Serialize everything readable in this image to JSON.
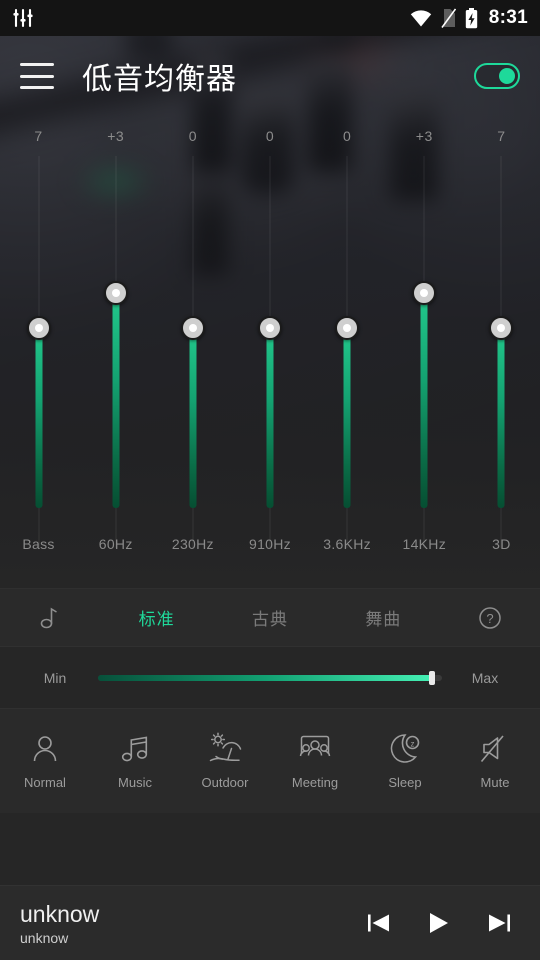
{
  "statusbar": {
    "left_icon": "equalizer-icon",
    "wifi_icon": "wifi-icon",
    "sim_icon": "no-sim-icon",
    "battery_icon": "battery-charging-icon",
    "time": "8:31"
  },
  "appbar": {
    "menu_icon": "hamburger-menu-icon",
    "title": "低音均衡器",
    "toggle_icon": "power-toggle",
    "toggle_on": true,
    "accent": "#1ed99a"
  },
  "equalizer": {
    "bands": [
      {
        "label": "Bass",
        "value": "7",
        "position": 0.3
      },
      {
        "label": "60Hz",
        "value": "+3",
        "position": 0.39
      },
      {
        "label": "230Hz",
        "value": "0",
        "position": 0.3
      },
      {
        "label": "910Hz",
        "value": "0",
        "position": 0.3
      },
      {
        "label": "3.6KHz",
        "value": "0",
        "position": 0.3
      },
      {
        "label": "14KHz",
        "value": "+3",
        "position": 0.39
      },
      {
        "label": "3D",
        "value": "7",
        "position": 0.3
      }
    ]
  },
  "presets": {
    "note_icon": "music-note-icon",
    "help_icon": "help-circle-icon",
    "tabs": [
      {
        "label": "标准",
        "active": true
      },
      {
        "label": "古典",
        "active": false
      },
      {
        "label": "舞曲",
        "active": false
      }
    ],
    "active_color": "#1fd99a"
  },
  "range": {
    "min_label": "Min",
    "max_label": "Max",
    "value_percent": 97
  },
  "modes": [
    {
      "label": "Normal",
      "icon": "person-icon"
    },
    {
      "label": "Music",
      "icon": "music-notes-icon"
    },
    {
      "label": "Outdoor",
      "icon": "beach-umbrella-icon"
    },
    {
      "label": "Meeting",
      "icon": "meeting-people-icon"
    },
    {
      "label": "Sleep",
      "icon": "moon-sleep-icon"
    },
    {
      "label": "Mute",
      "icon": "speaker-mute-icon"
    }
  ],
  "player": {
    "title": "unknow",
    "artist": "unknow",
    "prev_icon": "skip-previous-icon",
    "play_icon": "play-icon",
    "next_icon": "skip-next-icon"
  }
}
